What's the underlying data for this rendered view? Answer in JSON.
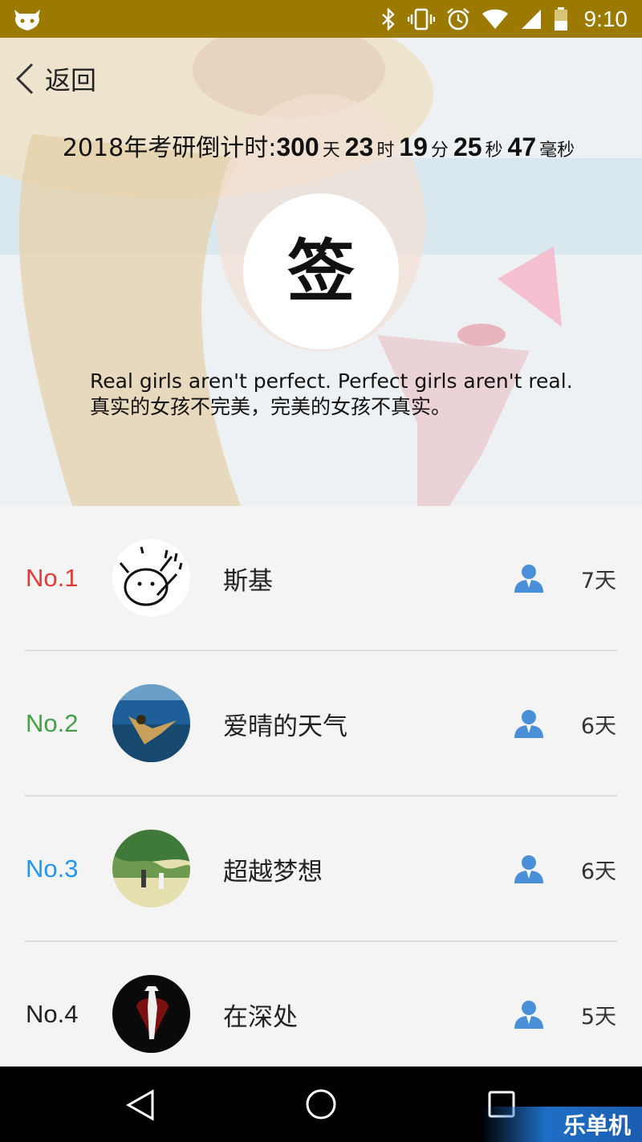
{
  "status_bar": {
    "time": "9:10"
  },
  "header": {
    "back_label": "返回",
    "countdown": {
      "prefix": "2018年考研倒计时:",
      "days": "300",
      "days_unit": "天",
      "hours": "23",
      "hours_unit": "时",
      "minutes": "19",
      "minutes_unit": "分",
      "seconds": "25",
      "seconds_unit": "秒",
      "ms": "47",
      "ms_unit": "毫秒"
    },
    "sign_label": "签",
    "quote_en": "Real girls aren't perfect. Perfect girls aren't real.",
    "quote_zh": "真实的女孩不完美，完美的女孩不真实。"
  },
  "ranking": [
    {
      "rank": "No.1",
      "name": "斯基",
      "days": "7天",
      "rank_color": "#e53935"
    },
    {
      "rank": "No.2",
      "name": "爱晴的天气",
      "days": "6天",
      "rank_color": "#43a047"
    },
    {
      "rank": "No.3",
      "name": "超越梦想",
      "days": "6天",
      "rank_color": "#2196f3"
    },
    {
      "rank": "No.4",
      "name": "在深处",
      "days": "5天",
      "rank_color": "#222222"
    }
  ],
  "watermark": "乐单机",
  "colors": {
    "status_bar": "#9c7a00",
    "user_icon": "#4a90d9"
  }
}
